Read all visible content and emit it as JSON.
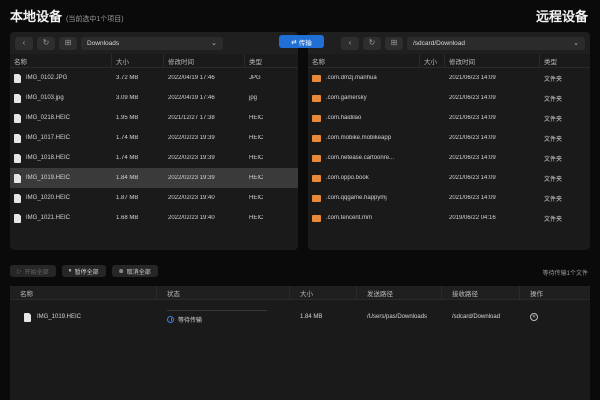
{
  "header": {
    "local_title": "本地设备",
    "local_subtitle": "(当前选中1个项目)",
    "remote_title": "远程设备"
  },
  "transfer_button": {
    "label": "传输",
    "icon": "transfer-arrows-icon"
  },
  "local": {
    "path": "Downloads",
    "columns": [
      "名称",
      "大小",
      "修改时间",
      "类型"
    ],
    "files": [
      {
        "name": "IMG_0102.JPG",
        "size": "3.72 MB",
        "modified": "2022/04/19 17:46",
        "type": "JPG"
      },
      {
        "name": "IMG_0103.jpg",
        "size": "3.09 MB",
        "modified": "2022/04/19 17:46",
        "type": "jpg"
      },
      {
        "name": "IMG_0218.HEIC",
        "size": "1.95 MB",
        "modified": "2021/12/27 17:38",
        "type": "HEIC"
      },
      {
        "name": "IMG_1017.HEIC",
        "size": "1.74 MB",
        "modified": "2022/02/23 19:39",
        "type": "HEIC"
      },
      {
        "name": "IMG_1018.HEIC",
        "size": "1.74 MB",
        "modified": "2022/02/23 19:39",
        "type": "HEIC"
      },
      {
        "name": "IMG_1019.HEIC",
        "size": "1.84 MB",
        "modified": "2022/02/23 19:39",
        "type": "HEIC",
        "selected": true
      },
      {
        "name": "IMG_1020.HEIC",
        "size": "1.87 MB",
        "modified": "2022/02/23 19:40",
        "type": "HEIC"
      },
      {
        "name": "IMG_1021.HEIC",
        "size": "1.68 MB",
        "modified": "2022/02/23 19:40",
        "type": "HEIC"
      }
    ]
  },
  "remote": {
    "path": "/sdcard/Download",
    "columns": [
      "名称",
      "大小",
      "修改时间",
      "类型"
    ],
    "files": [
      {
        "name": ".com.dmzj.manhua",
        "size": "",
        "modified": "2021/06/23 14:09",
        "type": "文件夹"
      },
      {
        "name": ".com.gamersky",
        "size": "",
        "modified": "2021/06/23 14:09",
        "type": "文件夹"
      },
      {
        "name": ".com.haidilao",
        "size": "",
        "modified": "2021/06/23 14:09",
        "type": "文件夹"
      },
      {
        "name": ".com.mobike.mobikeapp",
        "size": "",
        "modified": "2021/06/23 14:09",
        "type": "文件夹"
      },
      {
        "name": ".com.netease.cartoonre...",
        "size": "",
        "modified": "2021/06/23 14:09",
        "type": "文件夹"
      },
      {
        "name": ".com.oppo.book",
        "size": "",
        "modified": "2021/06/23 14:09",
        "type": "文件夹"
      },
      {
        "name": ".com.qqgame.happymj",
        "size": "",
        "modified": "2021/06/23 14:09",
        "type": "文件夹"
      },
      {
        "name": ".com.tencent.mm",
        "size": "",
        "modified": "2019/06/22 04:16",
        "type": "文件夹"
      }
    ]
  },
  "actions": {
    "start_all": "开始全部",
    "pause_all": "暂停全部",
    "cancel_all": "取消全部",
    "waiting_count": "等待传输1个文件"
  },
  "queue": {
    "columns": [
      "名称",
      "状态",
      "大小",
      "发送路径",
      "接收路径",
      "操作"
    ],
    "items": [
      {
        "name": "IMG_1019.HEIC",
        "status": "等待传输",
        "progress": 0,
        "size": "1.84 MB",
        "send_path": "/Users/pas/Downloads",
        "recv_path": "/sdcard/Download"
      }
    ]
  },
  "colors": {
    "accent": "#1f6fd6",
    "folder": "#e8893a",
    "selected_row": "#3a3a3a"
  }
}
